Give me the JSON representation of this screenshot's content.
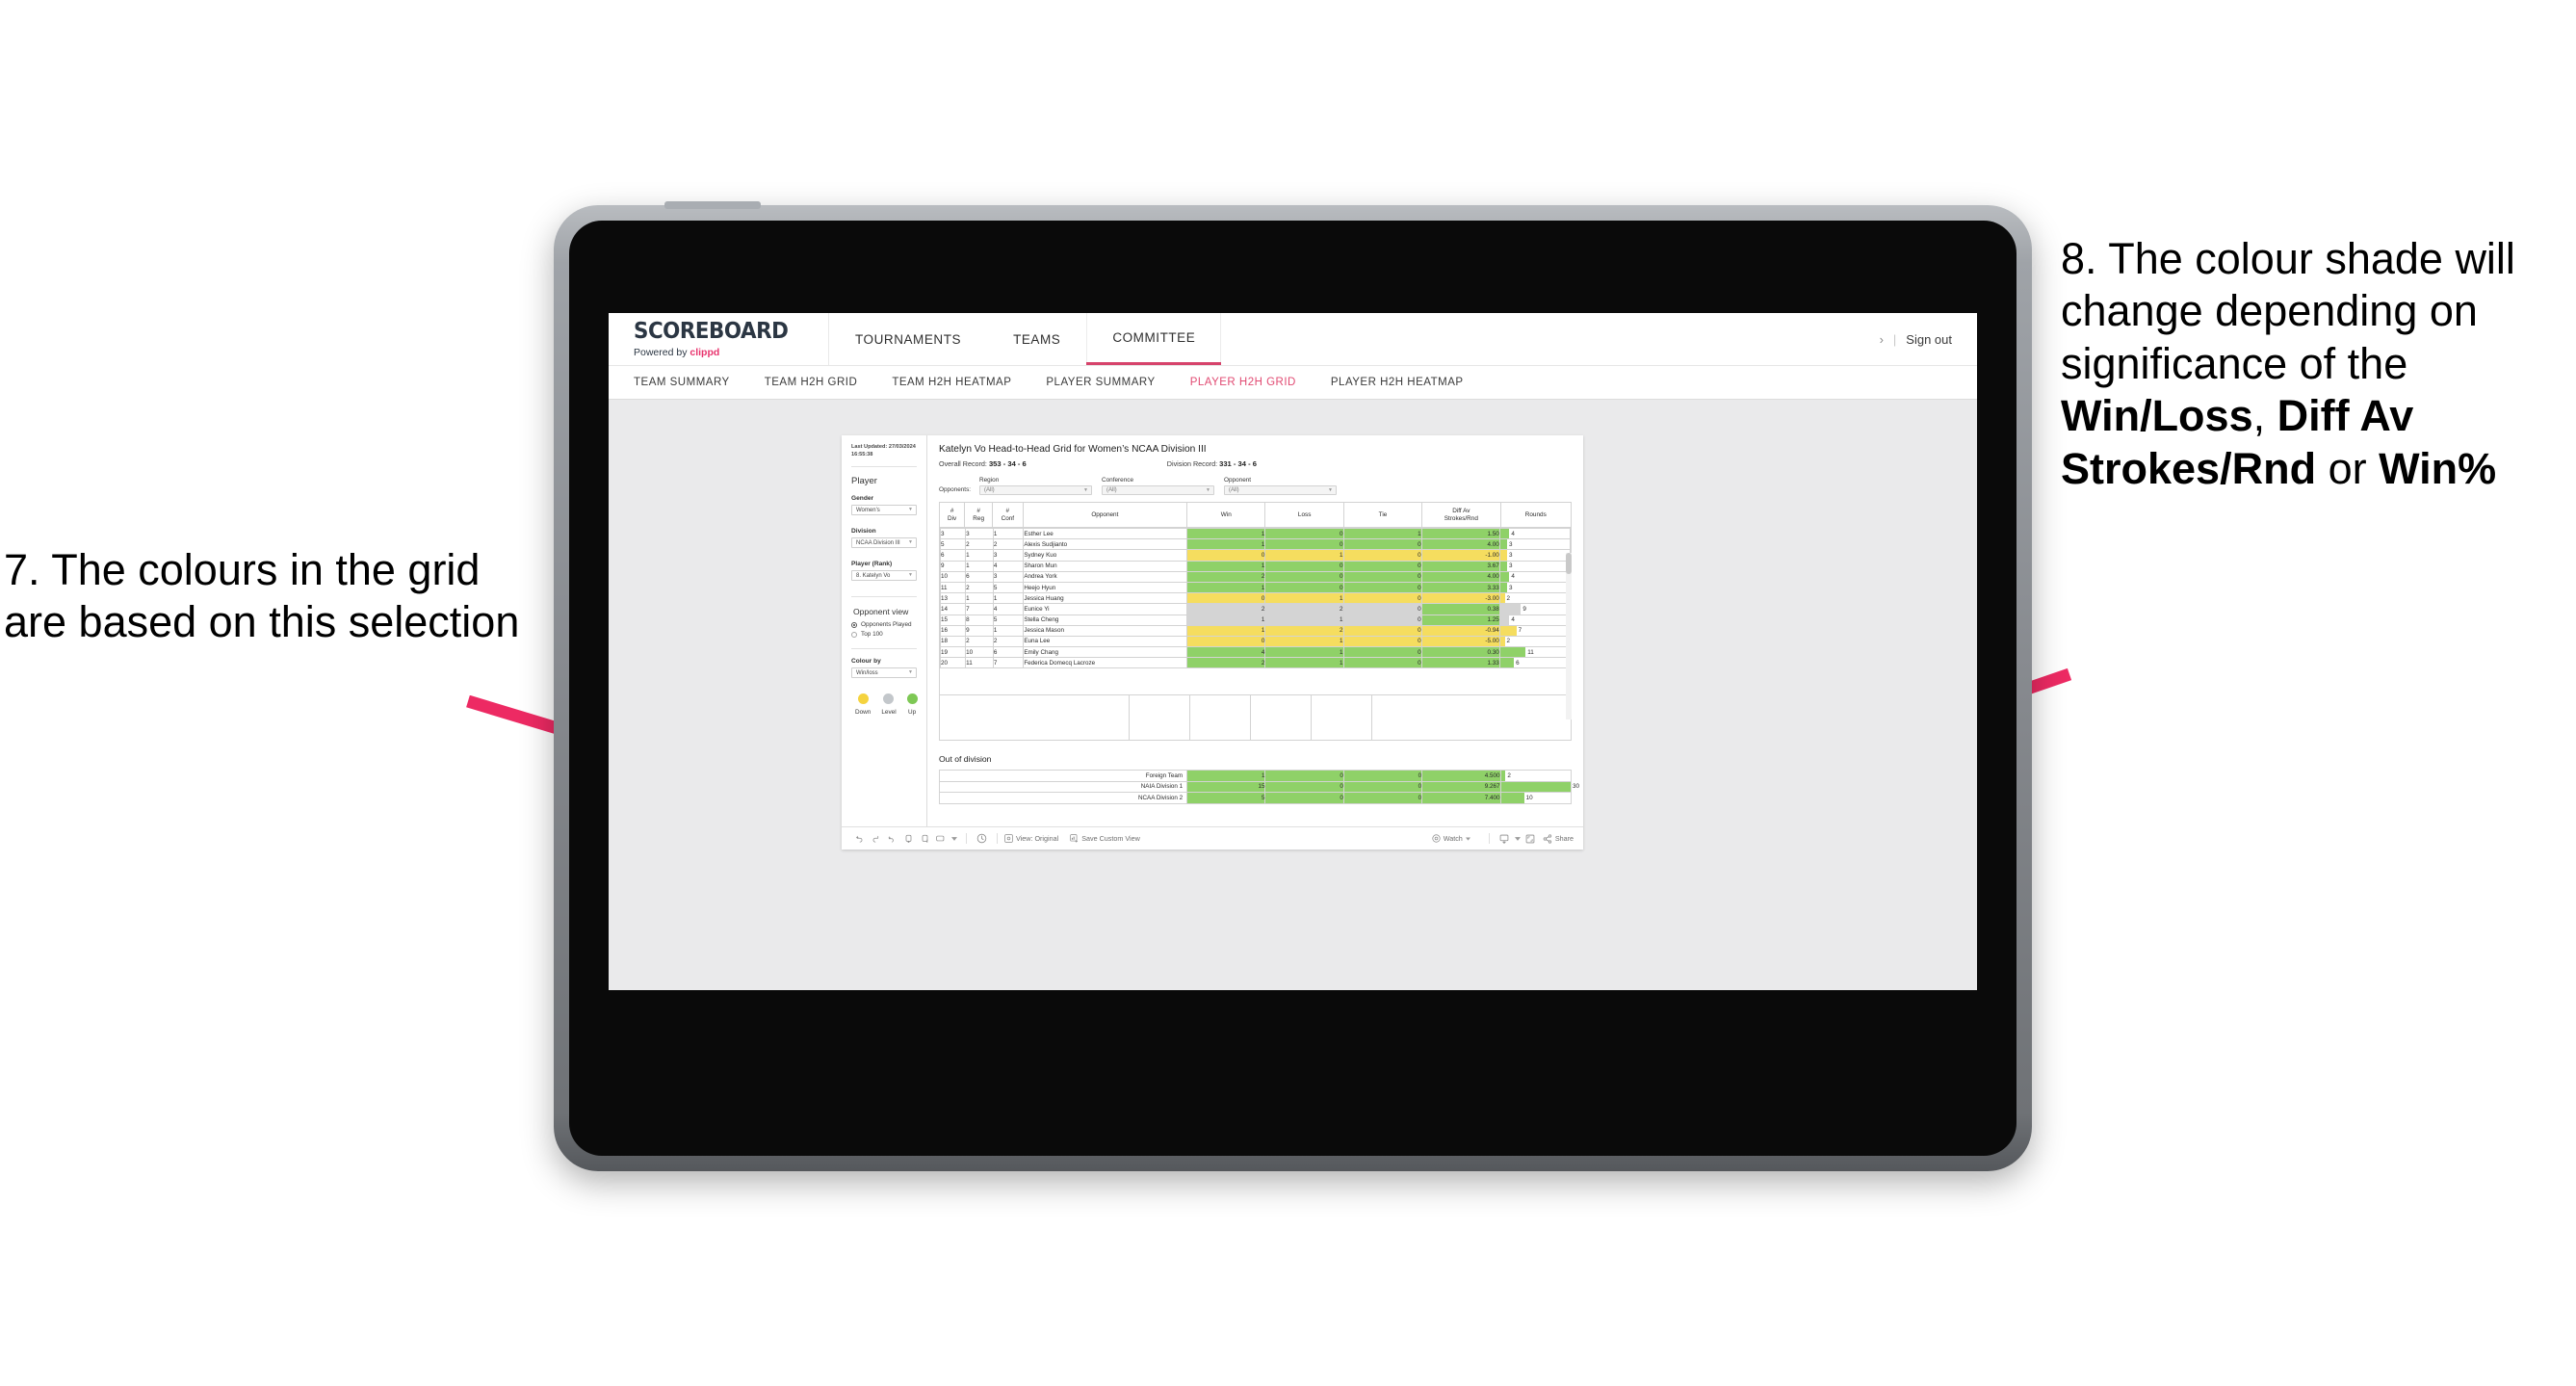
{
  "annotations": {
    "left": "7. The colours in the grid are based on this selection",
    "right_pre": "8. The colour shade will change depending on significance of the ",
    "right_b1": "Win/Loss",
    "right_mid1": ", ",
    "right_b2": "Diff Av Strokes/Rnd",
    "right_mid2": " or ",
    "right_b3": "Win%",
    "arrow_color": "#ed2a63"
  },
  "app": {
    "brand_title": "SCOREBOARD",
    "brand_sub_prefix": "Powered by ",
    "brand_sub_accent": "clippd",
    "accent_color": "#e8336d",
    "topnav": [
      {
        "label": "TOURNAMENTS",
        "active": false
      },
      {
        "label": "TEAMS",
        "active": false
      },
      {
        "label": "COMMITTEE",
        "active": true
      }
    ],
    "signout": {
      "chevron": "›",
      "divider": "|",
      "label": "Sign out"
    },
    "subnav": [
      {
        "label": "TEAM SUMMARY",
        "active": false
      },
      {
        "label": "TEAM H2H GRID",
        "active": false
      },
      {
        "label": "TEAM H2H HEATMAP",
        "active": false
      },
      {
        "label": "PLAYER SUMMARY",
        "active": false
      },
      {
        "label": "PLAYER H2H GRID",
        "active": true
      },
      {
        "label": "PLAYER H2H HEATMAP",
        "active": false
      }
    ]
  },
  "panel": {
    "last_updated": "Last Updated: 27/03/2024 16:55:38",
    "section_player": "Player",
    "gender": {
      "label": "Gender",
      "value": "Women’s"
    },
    "division": {
      "label": "Division",
      "value": "NCAA Division III"
    },
    "player_rank": {
      "label": "Player (Rank)",
      "value": "8. Katelyn Vo"
    },
    "opponent_view": {
      "title": "Opponent view",
      "options": [
        {
          "label": "Opponents Played",
          "selected": true
        },
        {
          "label": "Top 100",
          "selected": false
        }
      ]
    },
    "colour_by": {
      "label": "Colour by",
      "value": "Win/loss"
    },
    "legend": [
      {
        "label": "Down",
        "color": "#f5d33f"
      },
      {
        "label": "Level",
        "color": "#c3c7cb"
      },
      {
        "label": "Up",
        "color": "#7ec855"
      }
    ]
  },
  "viz": {
    "title": "Katelyn Vo Head-to-Head Grid for Women’s NCAA Division III",
    "overall_record_label": "Overall Record:",
    "overall_record_value": "353 -  34 - 6",
    "division_record_label": "Division Record:",
    "division_record_value": "331 -  34 - 6",
    "opponents_label": "Opponents:",
    "opponent_filters": [
      {
        "label": "Region",
        "value": "(All)"
      },
      {
        "label": "Conference",
        "value": "(All)"
      },
      {
        "label": "Opponent",
        "value": "(All)"
      }
    ],
    "out_of_division_title": "Out of division"
  },
  "chart_data": {
    "type": "table",
    "title": "Katelyn Vo Head-to-Head Grid for Women’s NCAA Division III",
    "columns": [
      "# Div",
      "# Reg",
      "# Conf",
      "Opponent",
      "Win",
      "Loss",
      "Tie",
      "Diff Av Strokes/Rnd",
      "Rounds"
    ],
    "column_headers_multiline": [
      [
        "#",
        "Div"
      ],
      [
        "#",
        "Reg"
      ],
      [
        "#",
        "Conf"
      ],
      [
        "Opponent"
      ],
      [
        "Win"
      ],
      [
        "Loss"
      ],
      [
        "Tie"
      ],
      [
        "Diff Av",
        "Strokes/Rnd"
      ],
      [
        "Rounds"
      ]
    ],
    "colour_scale": {
      "up": "#8fd168",
      "level": "#d4d4d4",
      "down": "#f5dd5f"
    },
    "rounds_max": 30,
    "rows": [
      {
        "div": "3",
        "reg": "3",
        "conf": "1",
        "opponent": "Esther Lee",
        "win": "1",
        "loss": "0",
        "tie": "1",
        "diff": "1.50",
        "rounds": "4",
        "state": "up"
      },
      {
        "div": "5",
        "reg": "2",
        "conf": "2",
        "opponent": "Alexis Sudjianto",
        "win": "1",
        "loss": "0",
        "tie": "0",
        "diff": "4.00",
        "rounds": "3",
        "state": "up"
      },
      {
        "div": "6",
        "reg": "1",
        "conf": "3",
        "opponent": "Sydney Kuo",
        "win": "0",
        "loss": "1",
        "tie": "0",
        "diff": "-1.00",
        "rounds": "3",
        "state": "down"
      },
      {
        "div": "9",
        "reg": "1",
        "conf": "4",
        "opponent": "Sharon Mun",
        "win": "1",
        "loss": "0",
        "tie": "0",
        "diff": "3.67",
        "rounds": "3",
        "state": "up"
      },
      {
        "div": "10",
        "reg": "6",
        "conf": "3",
        "opponent": "Andrea York",
        "win": "2",
        "loss": "0",
        "tie": "0",
        "diff": "4.00",
        "rounds": "4",
        "state": "up"
      },
      {
        "div": "11",
        "reg": "2",
        "conf": "5",
        "opponent": "Heejo Hyun",
        "win": "1",
        "loss": "0",
        "tie": "0",
        "diff": "3.33",
        "rounds": "3",
        "state": "up"
      },
      {
        "div": "13",
        "reg": "1",
        "conf": "1",
        "opponent": "Jessica Huang",
        "win": "0",
        "loss": "1",
        "tie": "0",
        "diff": "-3.00",
        "rounds": "2",
        "state": "down"
      },
      {
        "div": "14",
        "reg": "7",
        "conf": "4",
        "opponent": "Eunice Yi",
        "win": "2",
        "loss": "2",
        "tie": "0",
        "diff": "0.38",
        "rounds": "9",
        "state": "level",
        "diff_state": "up"
      },
      {
        "div": "15",
        "reg": "8",
        "conf": "5",
        "opponent": "Stella Cheng",
        "win": "1",
        "loss": "1",
        "tie": "0",
        "diff": "1.25",
        "rounds": "4",
        "state": "level",
        "diff_state": "up"
      },
      {
        "div": "16",
        "reg": "9",
        "conf": "1",
        "opponent": "Jessica Mason",
        "win": "1",
        "loss": "2",
        "tie": "0",
        "diff": "-0.94",
        "rounds": "7",
        "state": "down"
      },
      {
        "div": "18",
        "reg": "2",
        "conf": "2",
        "opponent": "Euna Lee",
        "win": "0",
        "loss": "1",
        "tie": "0",
        "diff": "-5.00",
        "rounds": "2",
        "state": "down"
      },
      {
        "div": "19",
        "reg": "10",
        "conf": "6",
        "opponent": "Emily Chang",
        "win": "4",
        "loss": "1",
        "tie": "0",
        "diff": "0.30",
        "rounds": "11",
        "state": "up"
      },
      {
        "div": "20",
        "reg": "11",
        "conf": "7",
        "opponent": "Federica Domecq Lacroze",
        "win": "2",
        "loss": "1",
        "tie": "0",
        "diff": "1.33",
        "rounds": "6",
        "state": "up"
      }
    ],
    "out_of_division": [
      {
        "label": "Foreign Team",
        "win": "1",
        "loss": "0",
        "tie": "0",
        "diff": "4.500",
        "rounds": "2",
        "state": "up"
      },
      {
        "label": "NAIA Division 1",
        "win": "15",
        "loss": "0",
        "tie": "0",
        "diff": "9.267",
        "rounds": "30",
        "state": "up"
      },
      {
        "label": "NCAA Division 2",
        "win": "5",
        "loss": "0",
        "tie": "0",
        "diff": "7.400",
        "rounds": "10",
        "state": "up"
      }
    ]
  },
  "toolbar": {
    "view_label": "View: Original",
    "save_label": "Save Custom View",
    "watch_label": "Watch",
    "share_label": "Share"
  }
}
